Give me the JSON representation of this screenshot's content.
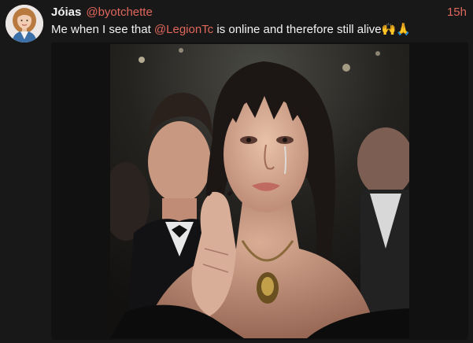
{
  "tweet": {
    "display_name": "Jóias",
    "handle": "@byotchette",
    "timestamp": "15h",
    "text_before": "Me when I see that ",
    "mention": "@LegionTc",
    "text_after": " is online and therefore still alive",
    "emojis": "🙌🙏"
  },
  "media": {
    "icon": "photo-of-crying-woman-at-event"
  },
  "colors": {
    "background": "#181818",
    "accent": "#e0675b",
    "text": "#f2f2f2"
  }
}
